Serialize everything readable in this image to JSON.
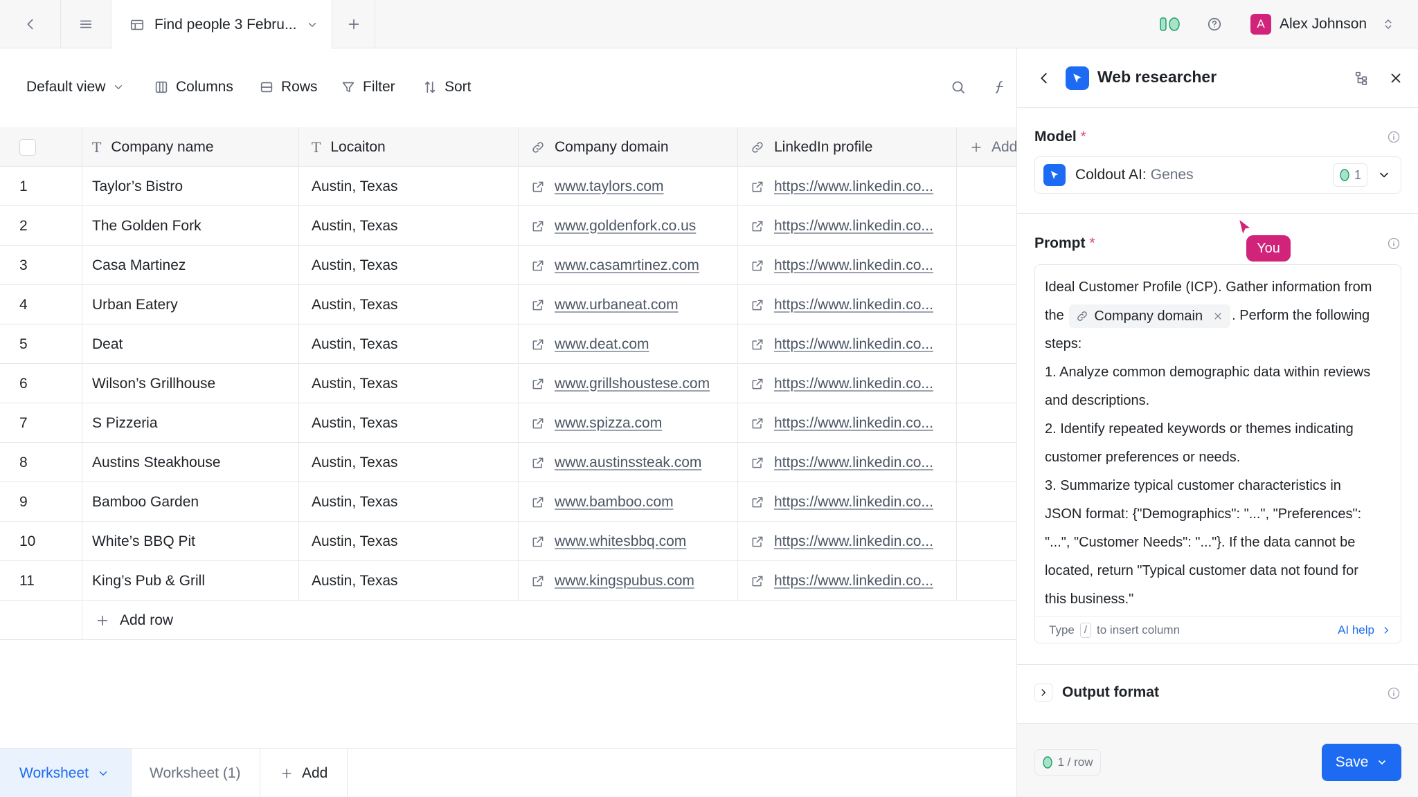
{
  "topbar": {
    "tab_title": "Find people 3 Febru...",
    "user_initial": "A",
    "user_name": "Alex Johnson",
    "avatar_color": "#d1237a"
  },
  "toolbar": {
    "view_label": "Default view",
    "columns_label": "Columns",
    "rows_label": "Rows",
    "filter_label": "Filter",
    "sort_label": "Sort"
  },
  "table": {
    "headers": {
      "company": "Company name",
      "location": "Locaiton",
      "domain": "Company domain",
      "linkedin": "LinkedIn profile",
      "add": "Add"
    },
    "rows": [
      {
        "num": "1",
        "company": "Taylor’s Bistro",
        "location": "Austin, Texas",
        "domain": "www.taylors.com",
        "linkedin": "https://www.linkedin.co..."
      },
      {
        "num": "2",
        "company": "The Golden Fork",
        "location": "Austin, Texas",
        "domain": "www.goldenfork.co.us",
        "linkedin": "https://www.linkedin.co..."
      },
      {
        "num": "3",
        "company": "Casa Martinez",
        "location": "Austin, Texas",
        "domain": "www.casamrtinez.com",
        "linkedin": "https://www.linkedin.co..."
      },
      {
        "num": "4",
        "company": "Urban Eatery",
        "location": "Austin, Texas",
        "domain": "www.urbaneat.com",
        "linkedin": "https://www.linkedin.co..."
      },
      {
        "num": "5",
        "company": "Deat",
        "location": "Austin, Texas",
        "domain": "www.deat.com",
        "linkedin": "https://www.linkedin.co..."
      },
      {
        "num": "6",
        "company": "Wilson’s Grillhouse",
        "location": "Austin, Texas",
        "domain": "www.grillshoustese.com",
        "linkedin": "https://www.linkedin.co..."
      },
      {
        "num": "7",
        "company": "S Pizzeria",
        "location": "Austin, Texas",
        "domain": "www.spizza.com",
        "linkedin": "https://www.linkedin.co..."
      },
      {
        "num": "8",
        "company": "Austins Steakhouse",
        "location": "Austin, Texas",
        "domain": "www.austinssteak.com",
        "linkedin": "https://www.linkedin.co..."
      },
      {
        "num": "9",
        "company": "Bamboo Garden",
        "location": "Austin, Texas",
        "domain": "www.bamboo.com",
        "linkedin": "https://www.linkedin.co..."
      },
      {
        "num": "10",
        "company": "White’s BBQ Pit",
        "location": "Austin, Texas",
        "domain": "www.whitesbbq.com",
        "linkedin": "https://www.linkedin.co..."
      },
      {
        "num": "11",
        "company": "King’s Pub & Grill",
        "location": "Austin, Texas",
        "domain": "www.kingspubus.com",
        "linkedin": "https://www.linkedin.co..."
      }
    ],
    "add_row_label": "Add row"
  },
  "sheets": {
    "active": "Worksheet",
    "second": "Worksheet (1)",
    "add_label": "Add"
  },
  "panel": {
    "title": "Web researcher",
    "model_label": "Model",
    "model_brand": "Coldout AI:",
    "model_name": "Genes",
    "model_credits": "1",
    "prompt_label": "Prompt",
    "prompt_line1": "Ideal Customer Profile (ICP). Gather information from",
    "prompt_pre_chip": "the",
    "prompt_chip": "Company domain",
    "prompt_post_chip": ". Perform the following",
    "prompt_line3": "steps:",
    "prompt_line4": "1. Analyze common demographic data within reviews",
    "prompt_line5": "and descriptions.",
    "prompt_line6": "2. Identify repeated keywords or themes indicating",
    "prompt_line7": "customer preferences or needs.",
    "prompt_line8": "3. Summarize typical customer characteristics in",
    "prompt_line9": "JSON format: {\"Demographics\": \"...\", \"Preferences\":",
    "prompt_line10": "\"...\", \"Customer Needs\": \"...\"}. If the data cannot be",
    "prompt_line11": "located, return \"Typical customer data not found for",
    "prompt_line12": "this business.\"",
    "footer_type": "Type",
    "footer_key": "/",
    "footer_insert": "to insert column",
    "ai_help": "AI help",
    "output_format_label": "Output format",
    "cost_label": "1 / row",
    "save_label": "Save",
    "accent_color": "#1d6bf3"
  },
  "cursor": {
    "tag_label": "You"
  }
}
